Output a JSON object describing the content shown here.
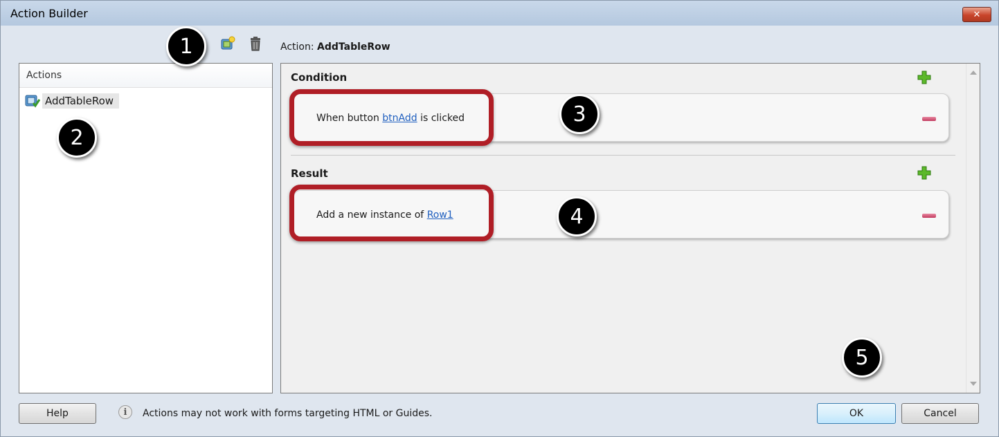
{
  "window": {
    "title": "Action Builder",
    "close_label": "✕"
  },
  "toolbar": {
    "action_prefix": "Action:",
    "action_name": "AddTableRow"
  },
  "actions_panel": {
    "header": "Actions",
    "items": [
      {
        "label": "AddTableRow"
      }
    ]
  },
  "condition": {
    "title": "Condition",
    "text_before": "When button ",
    "link": "btnAdd",
    "text_after": " is clicked"
  },
  "result": {
    "title": "Result",
    "text_before": "Add a new instance of ",
    "link": "Row1"
  },
  "callouts": [
    "1",
    "2",
    "3",
    "4",
    "5"
  ],
  "footer": {
    "help_label": "Help",
    "info_icon": "i",
    "info_text": "Actions may not work with forms targeting HTML or Guides.",
    "ok_label": "OK",
    "cancel_label": "Cancel"
  },
  "colors": {
    "highlight": "#b01e26",
    "link": "#1f5fbf",
    "plus": "#5cb82a",
    "minus": "#c23a5e"
  }
}
